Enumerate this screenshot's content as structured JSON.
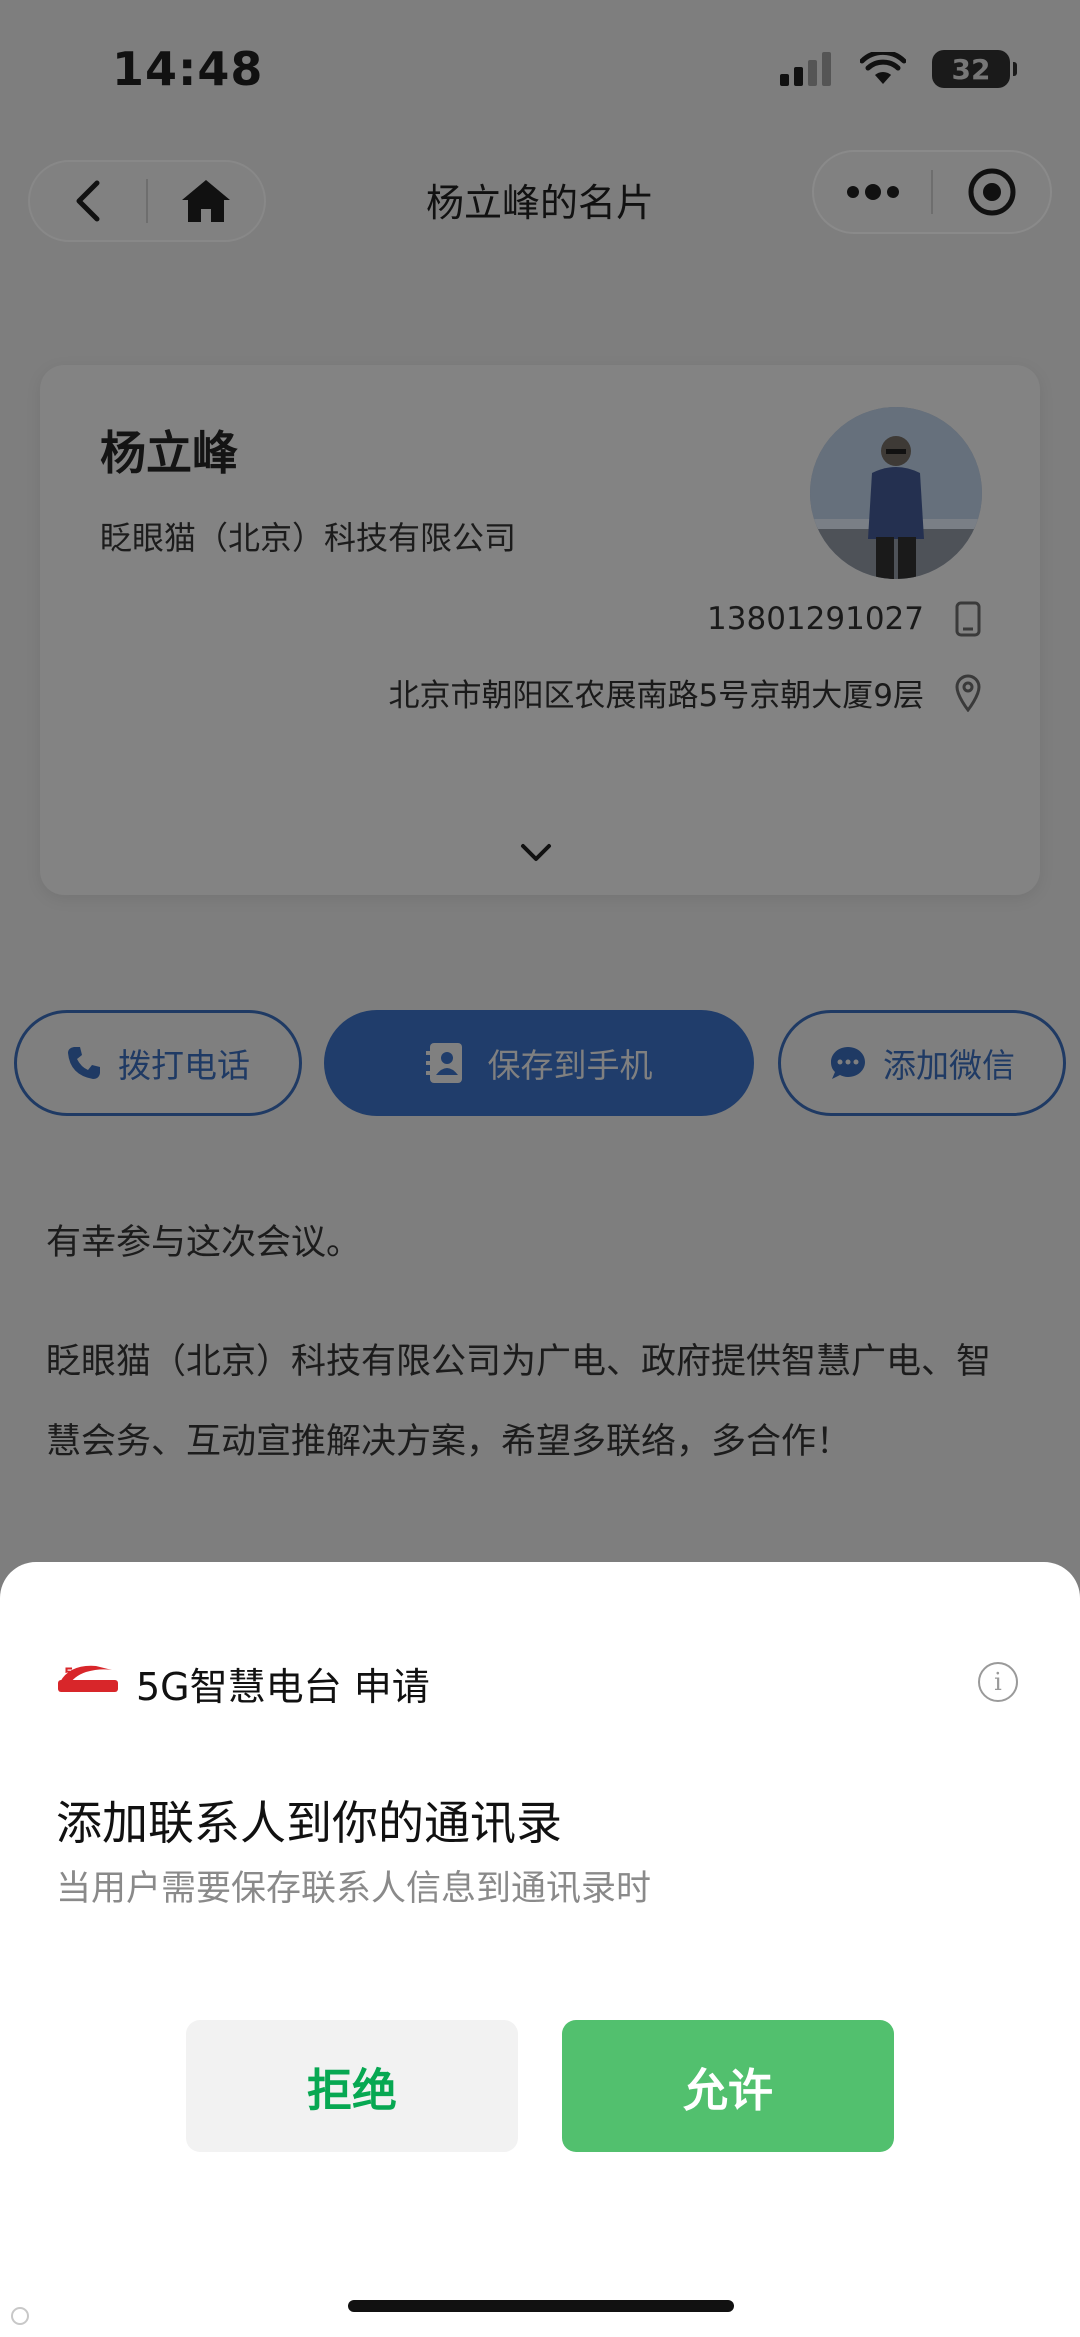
{
  "status_bar": {
    "time": "14:48",
    "battery": "32"
  },
  "nav": {
    "title": "杨立峰的名片"
  },
  "card": {
    "name": "杨立峰",
    "company": "眨眼猫（北京）科技有限公司",
    "phone": "13801291027",
    "address": "北京市朝阳区农展南路5号京朝大厦9层"
  },
  "actions": {
    "call": "拨打电话",
    "save": "保存到手机",
    "wechat": "添加微信"
  },
  "intro": {
    "line1": "有幸参与这次会议。",
    "para2": "眨眼猫（北京）科技有限公司为广电、政府提供智慧广电、智慧会务、互动宣推解决方案，希望多联络，多合作！"
  },
  "sheet": {
    "app_name": "5G智慧电台 申请",
    "title": "添加联系人到你的通讯录",
    "description": "当用户需要保存联系人信息到通讯录时",
    "deny": "拒绝",
    "allow": "允许"
  },
  "colors": {
    "overlay": "#7e7e7e",
    "primary_blue": "#203d6b",
    "allow_green": "#52c06e",
    "deny_text_green": "#07a852"
  }
}
